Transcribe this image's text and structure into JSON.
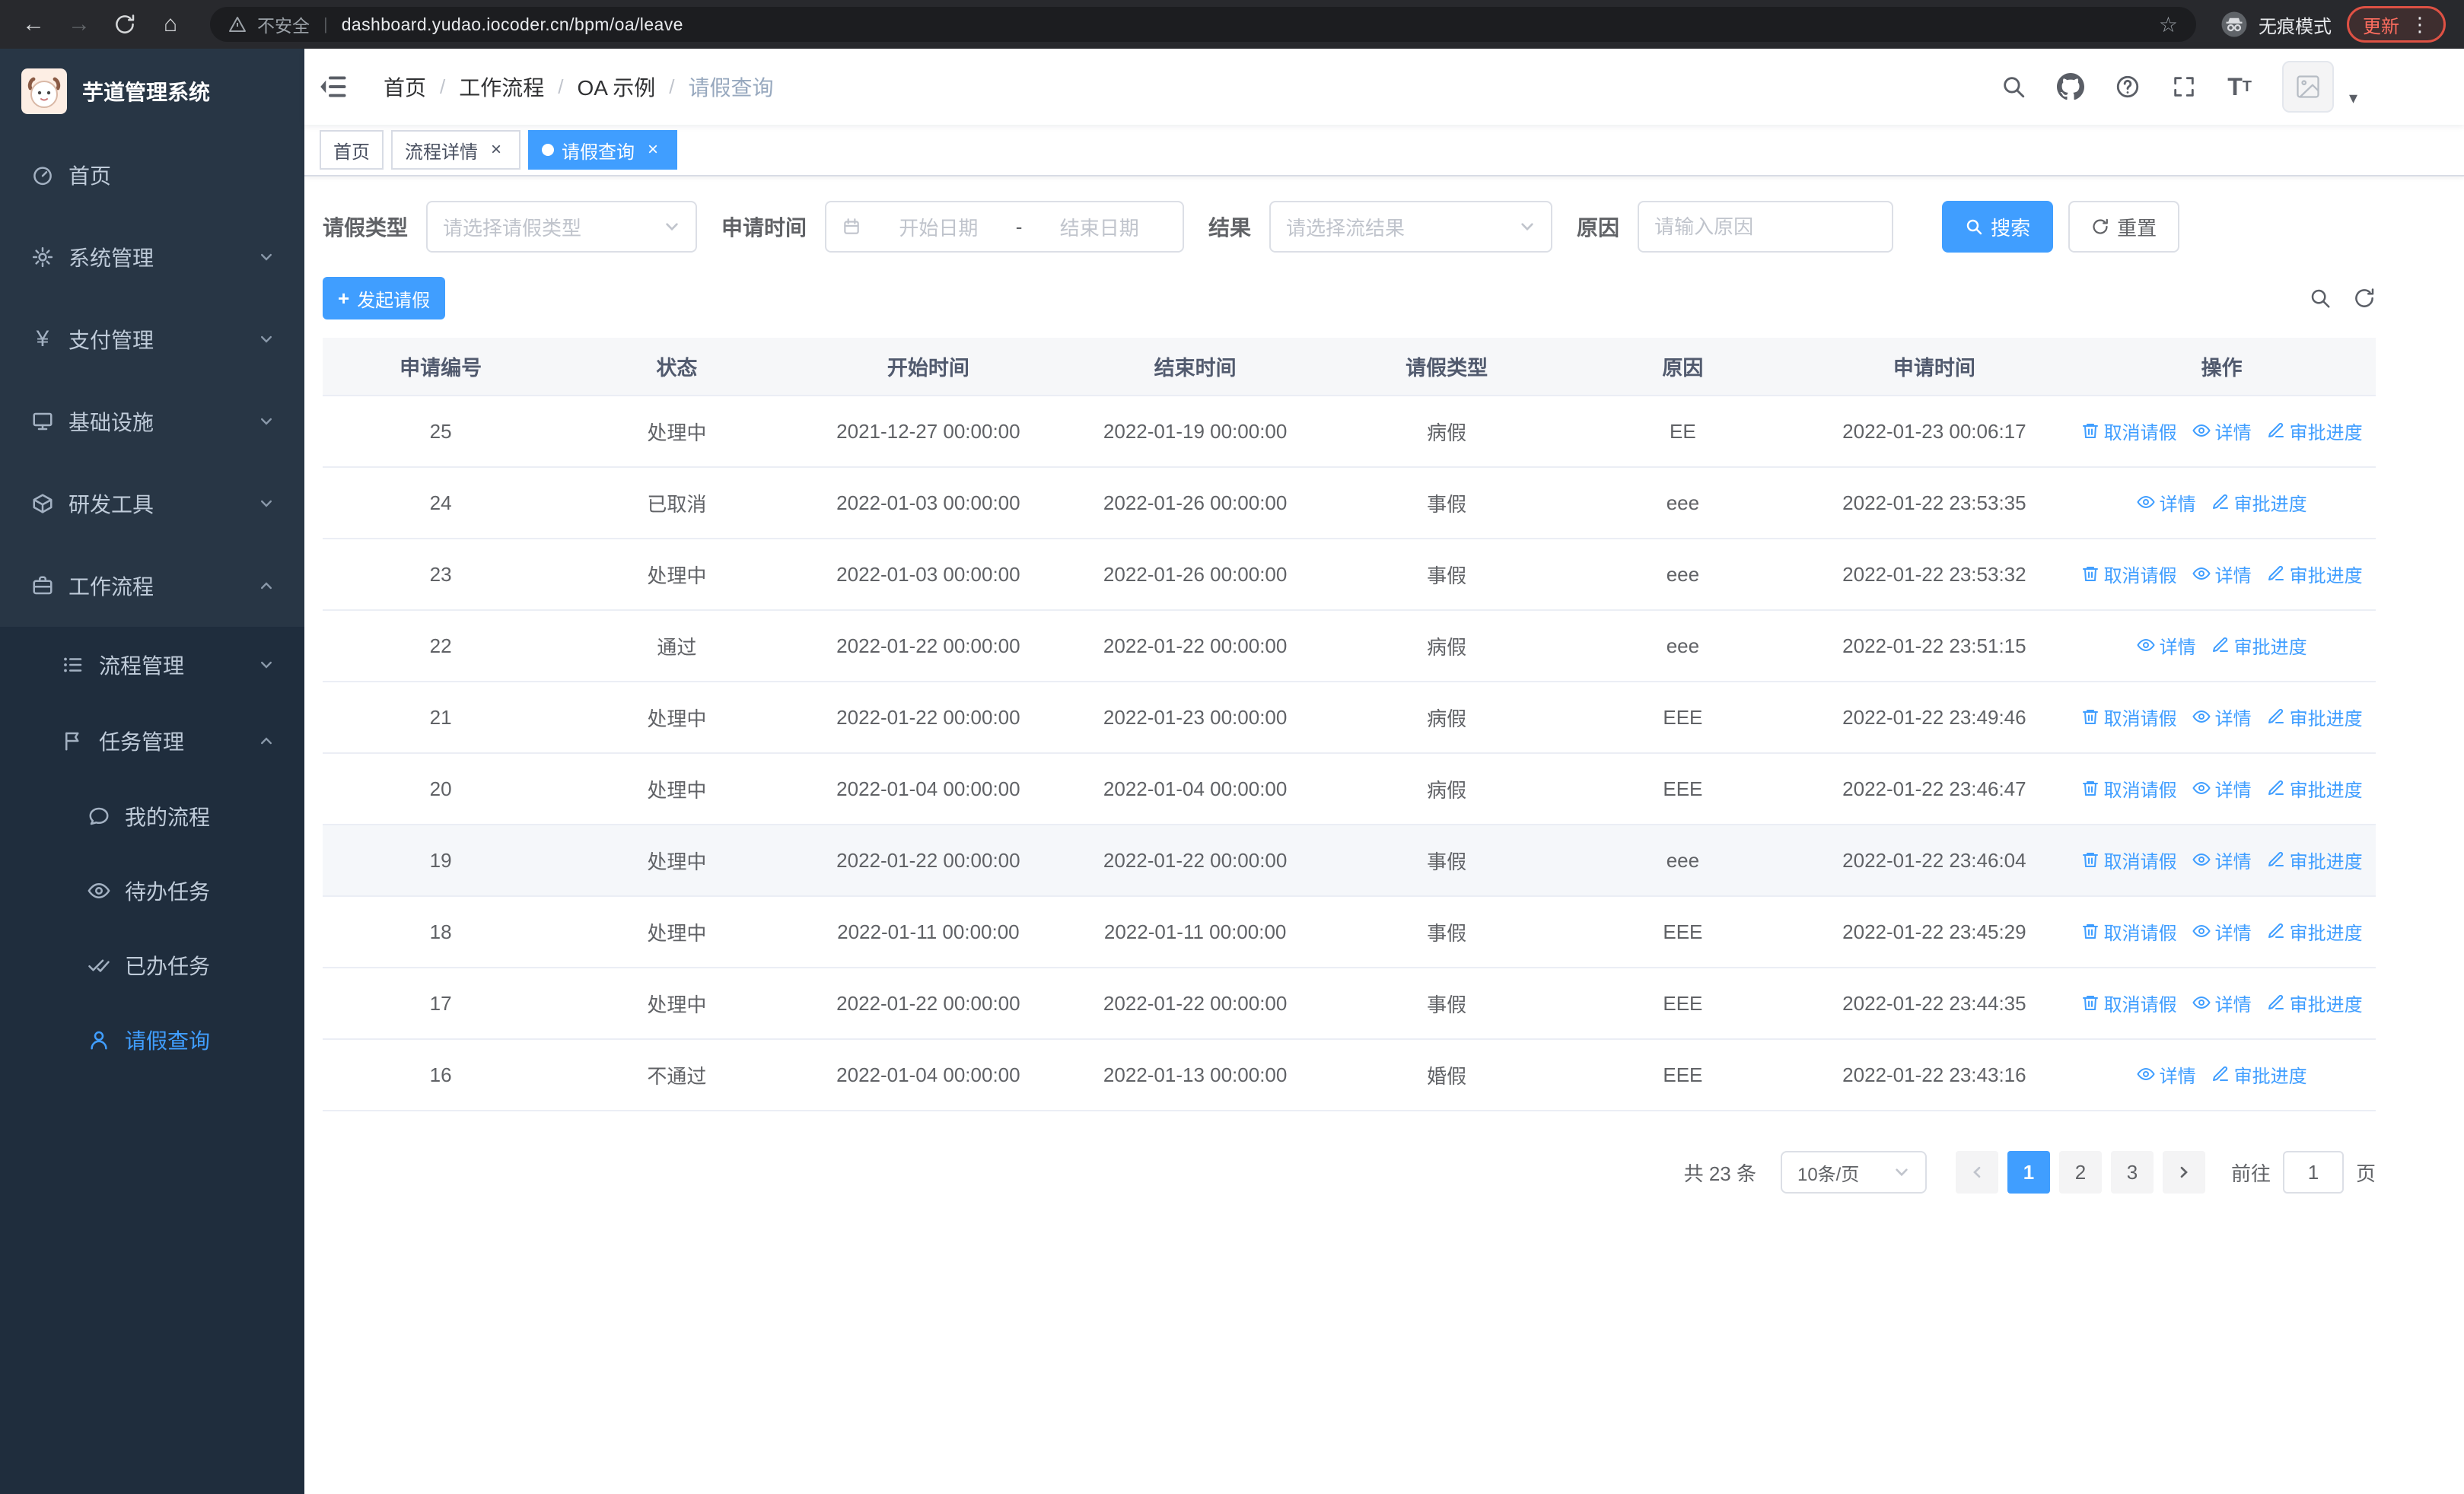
{
  "browser": {
    "security_label": "不安全",
    "url": "dashboard.yudao.iocoder.cn/bpm/oa/leave",
    "incognito_label": "无痕模式",
    "update_label": "更新"
  },
  "sidebar": {
    "logo_title": "芋道管理系统",
    "items": [
      {
        "label": "首页"
      },
      {
        "label": "系统管理"
      },
      {
        "label": "支付管理"
      },
      {
        "label": "基础设施"
      },
      {
        "label": "研发工具"
      },
      {
        "label": "工作流程"
      }
    ],
    "sub_items": [
      {
        "label": "流程管理"
      },
      {
        "label": "任务管理"
      }
    ],
    "leaf_items": [
      {
        "label": "我的流程"
      },
      {
        "label": "待办任务"
      },
      {
        "label": "已办任务"
      },
      {
        "label": "请假查询"
      }
    ]
  },
  "header": {
    "breadcrumb": [
      "首页",
      "工作流程",
      "OA 示例",
      "请假查询"
    ]
  },
  "tabs": [
    {
      "label": "首页"
    },
    {
      "label": "流程详情"
    },
    {
      "label": "请假查询"
    }
  ],
  "filters": {
    "leave_type_label": "请假类型",
    "leave_type_placeholder": "请选择请假类型",
    "apply_time_label": "申请时间",
    "start_date_placeholder": "开始日期",
    "range_separator": "-",
    "end_date_placeholder": "结束日期",
    "result_label": "结果",
    "result_placeholder": "请选择流结果",
    "reason_label": "原因",
    "reason_placeholder": "请输入原因",
    "search_button": "搜索",
    "reset_button": "重置"
  },
  "toolbar": {
    "create_button": "发起请假"
  },
  "table": {
    "columns": [
      "申请编号",
      "状态",
      "开始时间",
      "结束时间",
      "请假类型",
      "原因",
      "申请时间",
      "操作"
    ],
    "action_labels": {
      "cancel": "取消请假",
      "detail": "详情",
      "progress": "审批进度"
    },
    "rows": [
      {
        "id": "25",
        "status": "处理中",
        "start": "2021-12-27 00:00:00",
        "end": "2022-01-19 00:00:00",
        "type": "病假",
        "reason": "EE",
        "applied": "2022-01-23 00:06:17",
        "actions": [
          "cancel",
          "detail",
          "progress"
        ]
      },
      {
        "id": "24",
        "status": "已取消",
        "start": "2022-01-03 00:00:00",
        "end": "2022-01-26 00:00:00",
        "type": "事假",
        "reason": "eee",
        "applied": "2022-01-22 23:53:35",
        "actions": [
          "detail",
          "progress"
        ]
      },
      {
        "id": "23",
        "status": "处理中",
        "start": "2022-01-03 00:00:00",
        "end": "2022-01-26 00:00:00",
        "type": "事假",
        "reason": "eee",
        "applied": "2022-01-22 23:53:32",
        "actions": [
          "cancel",
          "detail",
          "progress"
        ]
      },
      {
        "id": "22",
        "status": "通过",
        "start": "2022-01-22 00:00:00",
        "end": "2022-01-22 00:00:00",
        "type": "病假",
        "reason": "eee",
        "applied": "2022-01-22 23:51:15",
        "actions": [
          "detail",
          "progress"
        ]
      },
      {
        "id": "21",
        "status": "处理中",
        "start": "2022-01-22 00:00:00",
        "end": "2022-01-23 00:00:00",
        "type": "病假",
        "reason": "EEE",
        "applied": "2022-01-22 23:49:46",
        "actions": [
          "cancel",
          "detail",
          "progress"
        ]
      },
      {
        "id": "20",
        "status": "处理中",
        "start": "2022-01-04 00:00:00",
        "end": "2022-01-04 00:00:00",
        "type": "病假",
        "reason": "EEE",
        "applied": "2022-01-22 23:46:47",
        "actions": [
          "cancel",
          "detail",
          "progress"
        ]
      },
      {
        "id": "19",
        "status": "处理中",
        "start": "2022-01-22 00:00:00",
        "end": "2022-01-22 00:00:00",
        "type": "事假",
        "reason": "eee",
        "applied": "2022-01-22 23:46:04",
        "actions": [
          "cancel",
          "detail",
          "progress"
        ],
        "highlighted": true
      },
      {
        "id": "18",
        "status": "处理中",
        "start": "2022-01-11 00:00:00",
        "end": "2022-01-11 00:00:00",
        "type": "事假",
        "reason": "EEE",
        "applied": "2022-01-22 23:45:29",
        "actions": [
          "cancel",
          "detail",
          "progress"
        ]
      },
      {
        "id": "17",
        "status": "处理中",
        "start": "2022-01-22 00:00:00",
        "end": "2022-01-22 00:00:00",
        "type": "事假",
        "reason": "EEE",
        "applied": "2022-01-22 23:44:35",
        "actions": [
          "cancel",
          "detail",
          "progress"
        ]
      },
      {
        "id": "16",
        "status": "不通过",
        "start": "2022-01-04 00:00:00",
        "end": "2022-01-13 00:00:00",
        "type": "婚假",
        "reason": "EEE",
        "applied": "2022-01-22 23:43:16",
        "actions": [
          "detail",
          "progress"
        ]
      }
    ]
  },
  "pagination": {
    "total_text": "共 23 条",
    "page_size": "10条/页",
    "pages": [
      "1",
      "2",
      "3"
    ],
    "goto_label": "前往",
    "goto_value": "1",
    "goto_suffix": "页"
  },
  "colors": {
    "primary": "#409eff",
    "sidebar_bg": "#283645",
    "submenu_bg": "#1f2d3d"
  }
}
